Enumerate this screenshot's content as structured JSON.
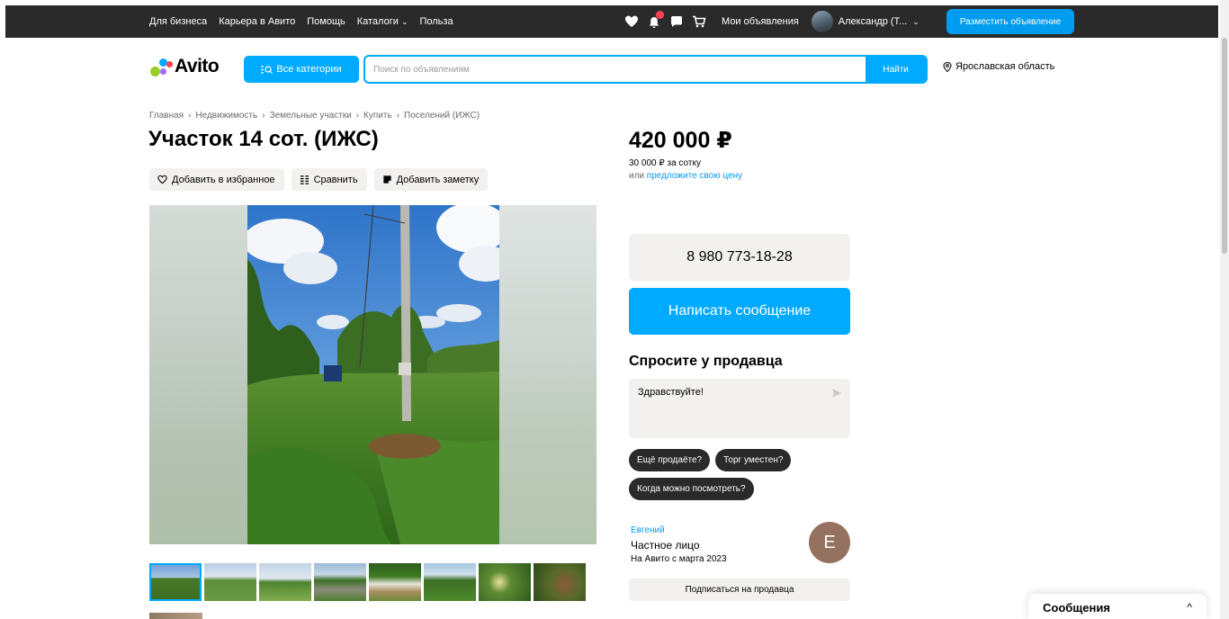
{
  "topbar": {
    "nav": [
      "Для бизнеса",
      "Карьера в Авито",
      "Помощь",
      "Каталоги",
      "Польза"
    ],
    "catalog_chevron": "⌄",
    "my_ads": "Мои объявления",
    "user_name": "Александр (Т...",
    "user_chevron": "⌄",
    "post_button": "Разместить объявление"
  },
  "header": {
    "logo": "Avito",
    "categories_button": "Все категории",
    "search_placeholder": "Поиск по объявлениям",
    "search_button": "Найти",
    "region": "Ярославская область"
  },
  "breadcrumbs": [
    "Главная",
    "Недвижимость",
    "Земельные участки",
    "Купить",
    "Поселений (ИЖС)"
  ],
  "breadcrumb_separator": "›",
  "listing": {
    "title": "Участок 14 сот. (ИЖС)",
    "actions": {
      "favorite": "Добавить в избранное",
      "compare": "Сравнить",
      "note": "Добавить заметку"
    },
    "thumbnail_count": 8
  },
  "pricing": {
    "price": "420 000 ₽",
    "per_unit": "30 000 ₽ за сотку",
    "offer_prefix": "или ",
    "offer_link": "предложите свою цену"
  },
  "contact": {
    "phone": "8 980 773-18-28",
    "message_button": "Написать сообщение"
  },
  "ask": {
    "title": "Спросите у продавца",
    "message": "Здравствуйте!",
    "chips": [
      "Ещё продаёте?",
      "Торг уместен?",
      "Когда можно посмотреть?"
    ]
  },
  "seller": {
    "name": "Евгений",
    "type": "Частное лицо",
    "since": "На Авито с марта 2023",
    "avatar_letter": "Е",
    "subscribe_button": "Подписаться на продавца"
  },
  "messages_widget": {
    "title": "Сообщения",
    "chevron": "^"
  },
  "colors": {
    "accent": "#00aaff",
    "topbar": "#2a2a2a",
    "link": "#0099f7",
    "badge": "#ff4053",
    "seller_avatar": "#957260"
  }
}
